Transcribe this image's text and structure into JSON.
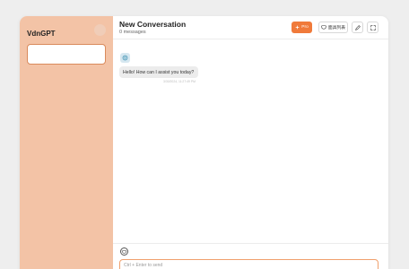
{
  "sidebar": {
    "brand": "VdnGPT"
  },
  "header": {
    "title": "New Conversation",
    "subtitle": "0 messages",
    "buttons": {
      "model_label": "Pro",
      "mask_label": "面具列表",
      "edit_icon": "pencil-icon",
      "fullscreen_icon": "expand-icon"
    }
  },
  "chat": {
    "messages": [
      {
        "role": "bot",
        "avatar_icon": "openai-icon",
        "text": "Hello! How can I assist you today?",
        "time": "3/30/2024, 11:27:49 PM"
      }
    ]
  },
  "composer": {
    "tool_icon": "mask-icon",
    "placeholder": "Ctrl + Enter to send"
  },
  "colors": {
    "sidebar_bg": "#f3c3a6",
    "accent": "#f07a3a",
    "background": "#eeeeee"
  }
}
